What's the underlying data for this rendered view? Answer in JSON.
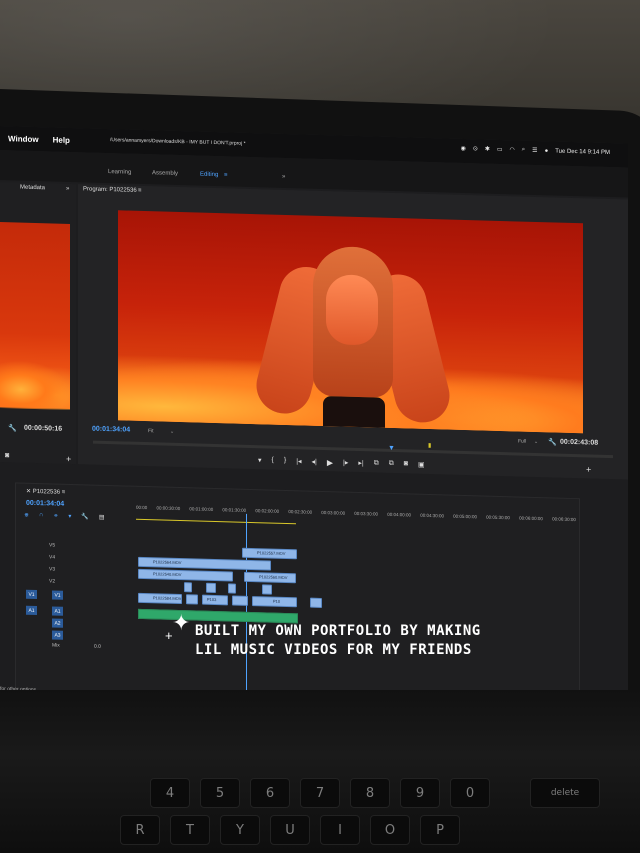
{
  "menubar": {
    "items": [
      "Window",
      "Help"
    ],
    "project_path": "/Users/annamyers/Downloads/KB - IMY BUT I DON'T.prproj *",
    "clock": "Tue Dec 14  9:14 PM"
  },
  "workspaces": {
    "learning": "Learning",
    "assembly": "Assembly",
    "editing": "Editing",
    "more": "»"
  },
  "source_panel": {
    "tab": "Metadata",
    "more": "»",
    "timecode": "00:00:50:16"
  },
  "program_monitor": {
    "title": "Program: P1022536",
    "timecode_current": "00:01:34:04",
    "fit": "Fit",
    "quality": "Full",
    "timecode_total": "00:02:43:08"
  },
  "timeline": {
    "sequence_name": "P1022536",
    "timecode": "00:01:34:04",
    "ruler": [
      "00:00",
      "00:00:30:00",
      "00:01:00:00",
      "00:01:30:00",
      "00:02:00:00",
      "00:02:30:00",
      "00:03:00:00",
      "00:03:30:00",
      "00:04:00:00",
      "00:04:30:00",
      "00:05:00:00",
      "00:05:30:00",
      "00:06:00:00",
      "00:06:30:00"
    ],
    "tracks": {
      "v5": "V5",
      "v4": "V4",
      "v3": "V3",
      "v2": "V2",
      "v1": "V1",
      "a1": "A1",
      "a2": "A2",
      "a3": "A3",
      "mix": "Mix",
      "mix_val": "0.0"
    },
    "clips": {
      "c1": "P1022557.MOV",
      "c2": "P1022564.MOV",
      "c3": "P1022540.MOV",
      "c4": "P1022560.MOV",
      "c5": "P1022584.MOV",
      "c6": "P103",
      "c7": "P10"
    },
    "hint": "for other options."
  },
  "caption": {
    "line1": "BUILT MY OWN PORTFOLIO BY MAKING",
    "line2": "LIL MUSIC VIDEOS FOR MY FRIENDS"
  },
  "keyboard": {
    "keys": [
      "$",
      "%",
      "^",
      "&",
      "*",
      "(",
      ")",
      "4",
      "5",
      "6",
      "7",
      "8",
      "9",
      "0",
      "R",
      "T",
      "Y",
      "U",
      "I",
      "O",
      "P",
      "delete"
    ]
  },
  "colors": {
    "accent": "#4fa3ff",
    "clip_video": "#8fb6e8",
    "clip_audio": "#2fa86a",
    "video_red": "#c7230a"
  }
}
